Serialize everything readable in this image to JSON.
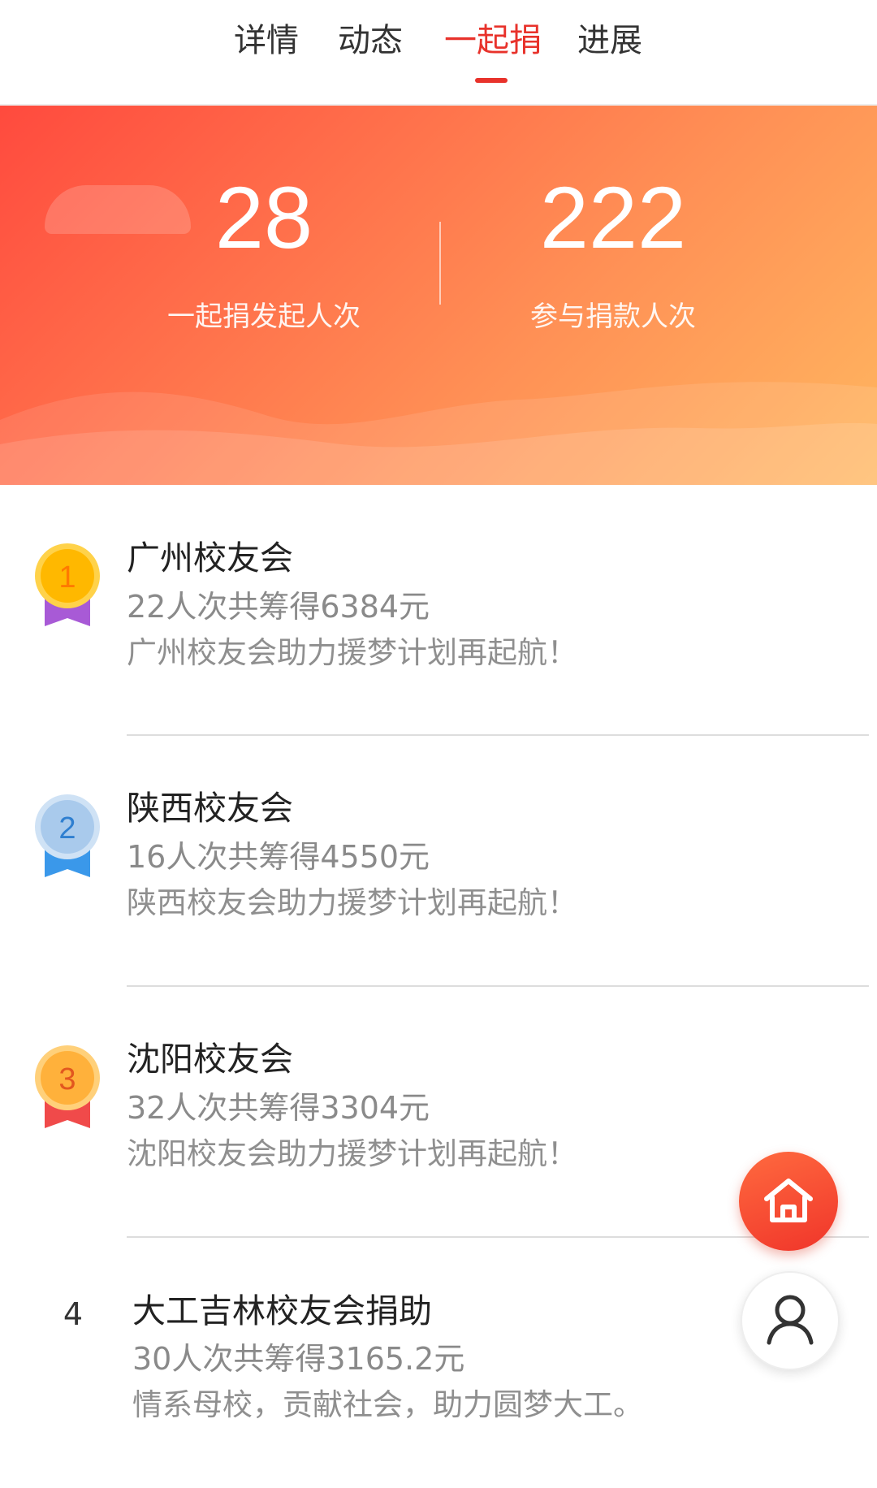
{
  "tabs": [
    {
      "label": "详情",
      "active": false
    },
    {
      "label": "动态",
      "active": false
    },
    {
      "label": "一起捐",
      "active": true
    },
    {
      "label": "进展",
      "active": false
    }
  ],
  "colors": {
    "accent": "#e8322b",
    "banner_start": "#ff4a3e",
    "banner_end": "#ffb760"
  },
  "stats": {
    "initiators_value": "28",
    "initiators_label": "一起捐发起人次",
    "participants_value": "222",
    "participants_label": "参与捐款人次"
  },
  "leaderboard": [
    {
      "rank": "1",
      "medal": "gold-medal-icon",
      "title": "广州校友会",
      "summary": "22人次共筹得6384元",
      "message": "广州校友会助力援梦计划再起航！"
    },
    {
      "rank": "2",
      "medal": "silver-medal-icon",
      "title": "陕西校友会",
      "summary": "16人次共筹得4550元",
      "message": "陕西校友会助力援梦计划再起航！"
    },
    {
      "rank": "3",
      "medal": "bronze-medal-icon",
      "title": "沈阳校友会",
      "summary": "32人次共筹得3304元",
      "message": "沈阳校友会助力援梦计划再起航！"
    },
    {
      "rank": "4",
      "medal": "",
      "title": "大工吉林校友会捐助",
      "summary": "30人次共筹得3165.2元",
      "message": "情系母校，贡献社会，助力圆梦大工。"
    }
  ],
  "fab": {
    "home_icon": "home-icon",
    "user_icon": "user-icon"
  }
}
